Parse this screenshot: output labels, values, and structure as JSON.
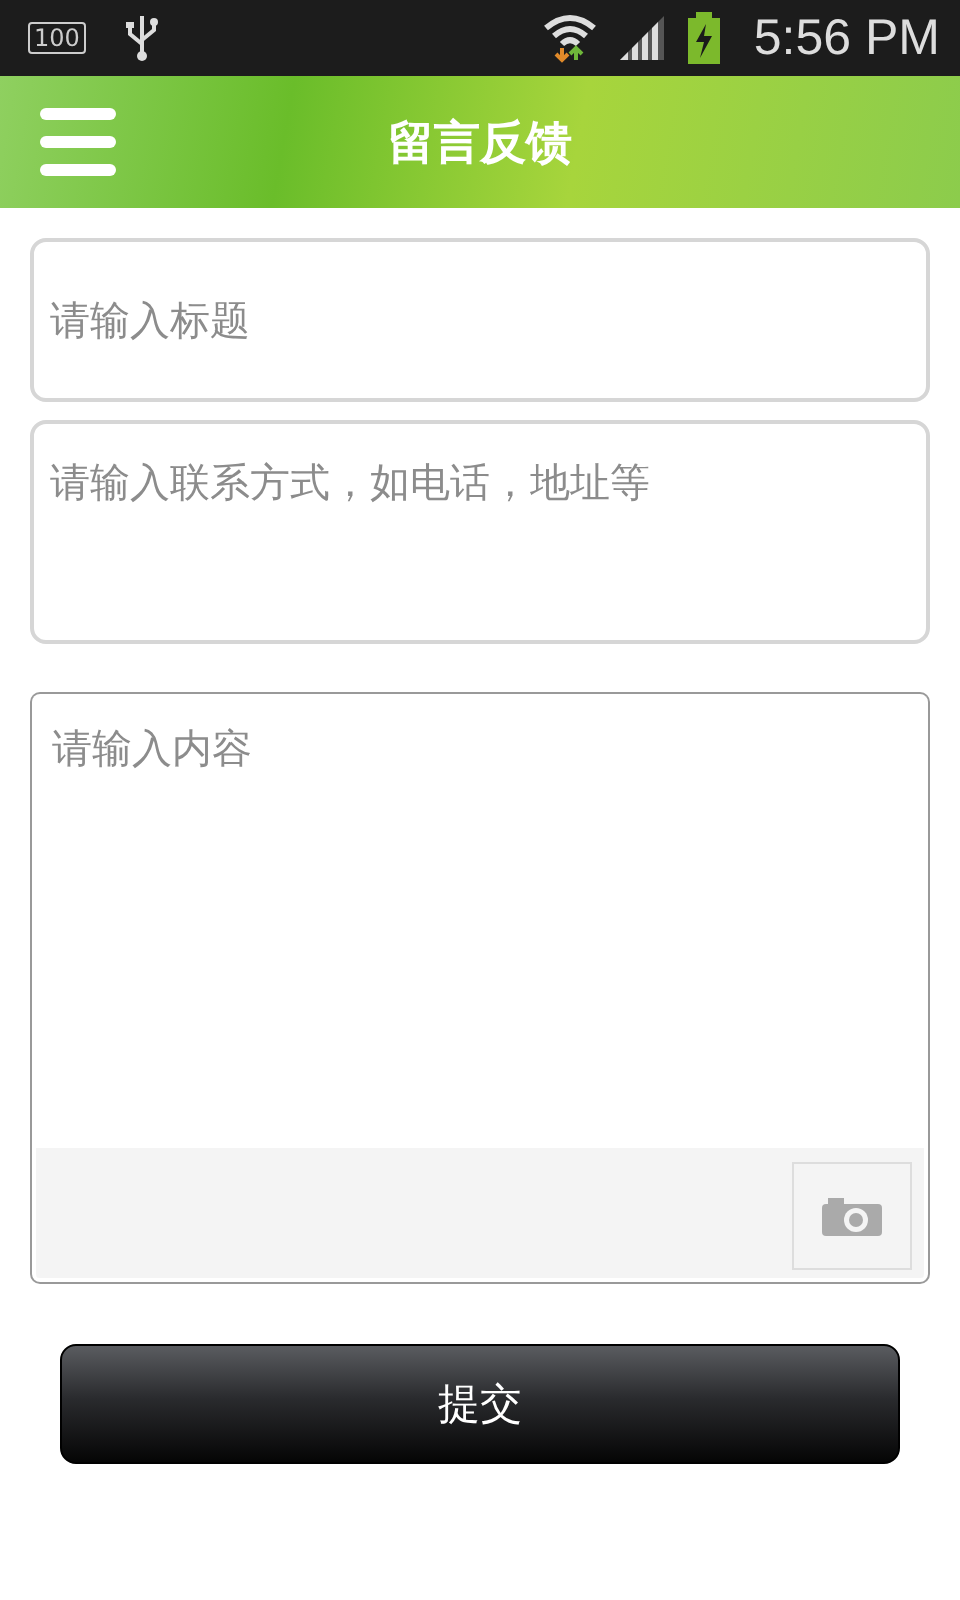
{
  "status_bar": {
    "battery_percent": "100",
    "time": "5:56 PM"
  },
  "header": {
    "title": "留言反馈"
  },
  "form": {
    "title_placeholder": "请输入标题",
    "contact_placeholder": "请输入联系方式，如电话，地址等",
    "content_placeholder": "请输入内容"
  },
  "submit_button": {
    "label": "提交"
  }
}
